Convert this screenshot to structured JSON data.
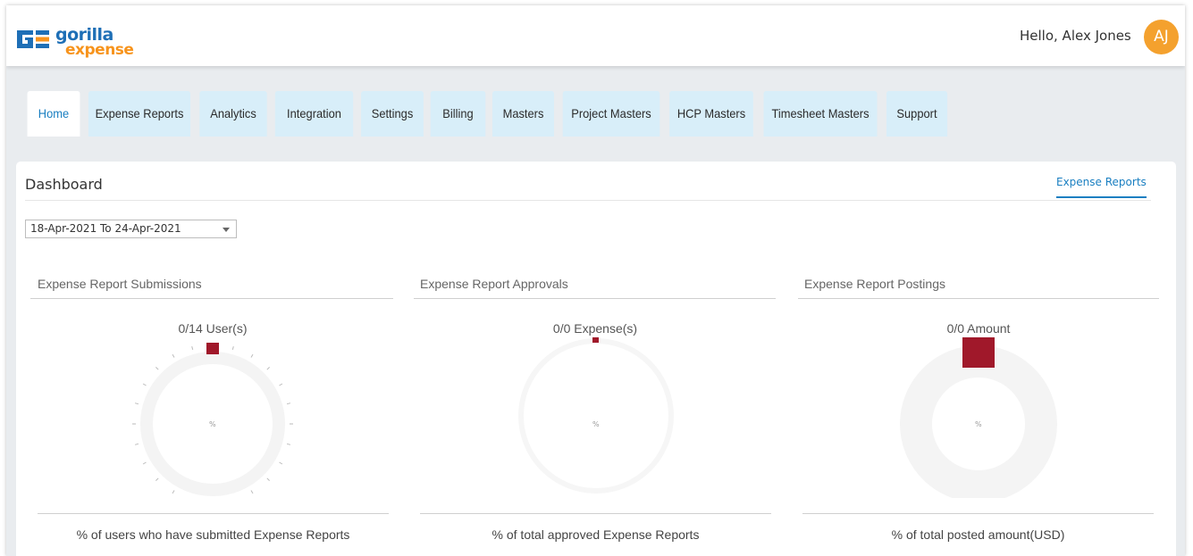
{
  "header": {
    "logo_word1": "gorilla",
    "logo_word2": "expense",
    "greeting": "Hello, Alex Jones",
    "avatar_initials": "AJ"
  },
  "tabs": [
    {
      "label": "Home",
      "active": true
    },
    {
      "label": "Expense Reports",
      "active": false
    },
    {
      "label": "Analytics",
      "active": false
    },
    {
      "label": "Integration",
      "active": false
    },
    {
      "label": "Settings",
      "active": false
    },
    {
      "label": "Billing",
      "active": false
    },
    {
      "label": "Masters",
      "active": false
    },
    {
      "label": "Project Masters",
      "active": false
    },
    {
      "label": "HCP Masters",
      "active": false
    },
    {
      "label": "Timesheet Masters",
      "active": false
    },
    {
      "label": "Support",
      "active": false
    }
  ],
  "dashboard": {
    "title": "Dashboard",
    "link": "Expense Reports",
    "date_range": "18-Apr-2021 To 24-Apr-2021"
  },
  "panels": [
    {
      "title": "Expense Report Submissions",
      "stat": "0/14 User(s)",
      "center": "%",
      "footer": "% of users who have submitted Expense Reports"
    },
    {
      "title": "Expense Report Approvals",
      "stat": "0/0 Expense(s)",
      "center": "%",
      "footer": "% of total approved Expense Reports"
    },
    {
      "title": "Expense Report Postings",
      "stat": "0/0 Amount",
      "center": "%",
      "footer": "% of total posted amount(USD)"
    }
  ],
  "colors": {
    "brand_blue": "#1e6fb6",
    "brand_orange": "#f7941d",
    "tab_bg": "#d8eef9",
    "accent_link": "#1a7fc1",
    "avatar_bg": "#f4a12e",
    "gauge_marker": "#a0182a",
    "gauge_track": "#f4f4f4"
  },
  "icons": {
    "logo": "gorilla-expense-logo",
    "dropdown": "caret-down-icon"
  }
}
